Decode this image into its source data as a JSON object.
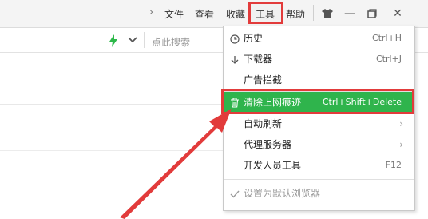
{
  "menubar": {
    "chevron": "›",
    "items": [
      "文件",
      "查看",
      "收藏",
      "工具",
      "帮助"
    ],
    "window_buttons": [
      "shirt-icon",
      "minimize-icon",
      "restore-icon",
      "close-icon"
    ],
    "highlight_color": "#e23b3b"
  },
  "addressbar": {
    "search_placeholder": "点此搜索",
    "lightning_color": "#2db84a"
  },
  "tools_menu": {
    "items": [
      {
        "icon": "clock-icon",
        "label": "历史",
        "shortcut": "Ctrl+H"
      },
      {
        "icon": "download-icon",
        "label": "下载器",
        "shortcut": "Ctrl+J"
      },
      {
        "icon": "",
        "label": "广告拦截",
        "shortcut": ""
      },
      {
        "icon": "trash-icon",
        "label": "清除上网痕迹",
        "shortcut": "Ctrl+Shift+Delete",
        "highlighted": true
      },
      {
        "icon": "",
        "label": "自动刷新",
        "submenu": true
      },
      {
        "icon": "",
        "label": "代理服务器",
        "submenu": true
      },
      {
        "icon": "",
        "label": "开发人员工具",
        "shortcut": "F12"
      },
      {
        "icon": "check-icon",
        "label": "设置为默认浏览器",
        "disabled": true
      }
    ],
    "highlight_color": "#2fb44c"
  },
  "arrow_color": "#e23b3b"
}
